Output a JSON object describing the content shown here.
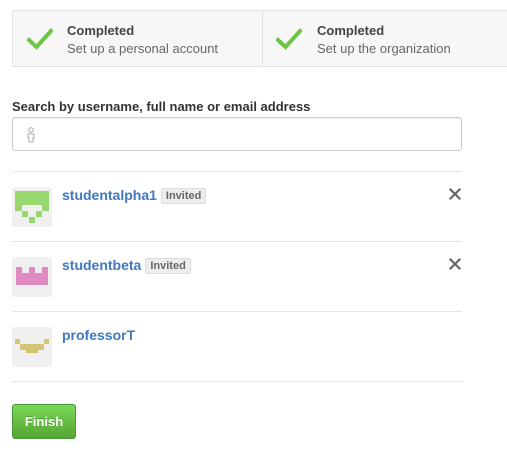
{
  "steps": [
    {
      "status": "Completed",
      "description": "Set up a personal account"
    },
    {
      "status": "Completed",
      "description": "Set up the organization"
    }
  ],
  "search": {
    "label": "Search by username, full name or email address",
    "value": "",
    "placeholder": ""
  },
  "members": [
    {
      "username": "studentalpha1",
      "badge": "Invited",
      "removable": true,
      "avatar_color": "#98d76f"
    },
    {
      "username": "studentbeta",
      "badge": "Invited",
      "removable": true,
      "avatar_color": "#e08ac2"
    },
    {
      "username": "professorT",
      "badge": "",
      "removable": false,
      "avatar_color": "#d4c372"
    }
  ],
  "colors": {
    "check": "#6cc644",
    "link": "#4078c0",
    "finish_button": "#6cc644"
  },
  "icons": {
    "step_status": "check-icon",
    "search": "person-icon",
    "remove": "close-icon"
  },
  "finish_button_label": "Finish"
}
